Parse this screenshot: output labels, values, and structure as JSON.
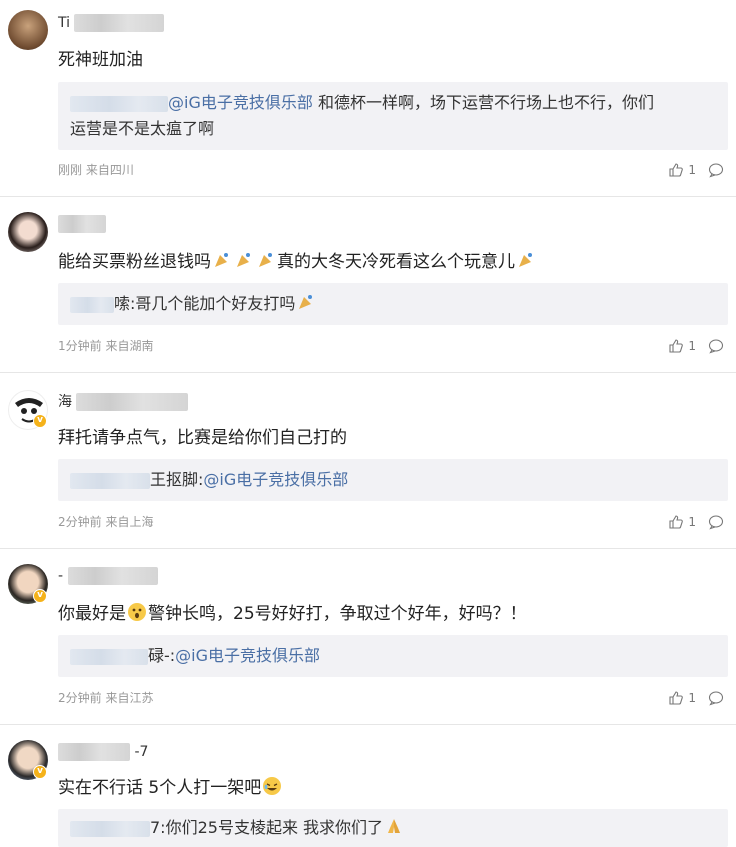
{
  "comments": [
    {
      "name_visible": "Ti",
      "text": "死神班加油",
      "reply_prefix": "",
      "reply_mid": "@iG电子竞技俱乐部",
      "reply_rest_line1": " 和德杯一样啊，场下运营不行场上也不行，你们",
      "reply_rest_line2": "运营是不是太瘟了啊",
      "time": "刚刚",
      "source": "来自四川",
      "likes": "1"
    },
    {
      "name_visible": "",
      "text": "能给买票粉丝退钱吗",
      "text_after": "真的大冬天冷死看这么个玩意儿",
      "reply_prefix": "嗦",
      "reply_mid": "",
      "reply_rest_line1": ":哥几个能加个好友打吗",
      "time": "1分钟前",
      "source": "来自湖南",
      "likes": "1"
    },
    {
      "name_visible": "海",
      "text": "拜托请争点气，比赛是给你们自己打的",
      "reply_prefix": "王抠脚:",
      "reply_mid": "@iG电子竞技俱乐部",
      "time": "2分钟前",
      "source": "来自上海",
      "likes": "1"
    },
    {
      "name_visible": "-",
      "text": "你最好是",
      "text_after": "警钟长鸣，25号好好打，争取过个好年，好吗？！",
      "reply_prefix": "碌-:",
      "reply_mid": "@iG电子竞技俱乐部",
      "time": "2分钟前",
      "source": "来自江苏",
      "likes": "1"
    },
    {
      "name_visible": "-7",
      "text": "实在不行话 5个人打一架吧",
      "reply_prefix": "7:",
      "reply_rest_line1": "你们25号支棱起来 我求你们了",
      "time": "",
      "source": "",
      "likes": ""
    }
  ],
  "icons": {
    "like": "thumbs-up-icon",
    "comment": "speech-bubble-icon",
    "badge": "verified-badge-icon"
  },
  "colors": {
    "mention": "#4a6fa5",
    "badge": "#f5b21a",
    "reply_bg": "#f2f2f5",
    "divider": "#e6e6e6"
  }
}
